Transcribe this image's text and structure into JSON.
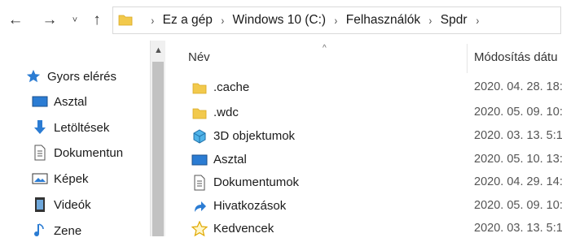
{
  "nav": {
    "back_icon": "←",
    "forward_icon": "→",
    "recent_icon": "˅",
    "up_icon": "↑"
  },
  "address": {
    "crumbs": [
      "Ez a gép",
      "Windows 10 (C:)",
      "Felhasználók",
      "Spdr"
    ],
    "separator": "›"
  },
  "sidebar": {
    "quick_access": "Gyors elérés",
    "items": [
      {
        "label": "Asztal",
        "icon": "desktop-icon",
        "pinned": true
      },
      {
        "label": "Letöltések",
        "icon": "download-icon",
        "pinned": true
      },
      {
        "label": "Dokumentun",
        "icon": "document-icon",
        "pinned": true
      },
      {
        "label": "Képek",
        "icon": "pictures-icon",
        "pinned": true
      },
      {
        "label": "Videók",
        "icon": "videos-icon",
        "pinned": false
      },
      {
        "label": "Zene",
        "icon": "music-icon",
        "pinned": false
      }
    ],
    "pin_glyph": "📌"
  },
  "scroll": {
    "up_glyph": "▲"
  },
  "columns": {
    "name": "Név",
    "date": "Módosítás dátu",
    "sort_indicator": "^"
  },
  "files": [
    {
      "name": ".cache",
      "icon": "folder-icon",
      "date": "2020. 04. 28. 18:"
    },
    {
      "name": ".wdc",
      "icon": "folder-icon",
      "date": "2020. 05. 09. 10:"
    },
    {
      "name": "3D objektumok",
      "icon": "3d-objects-icon",
      "date": "2020. 03. 13. 5:1"
    },
    {
      "name": "Asztal",
      "icon": "desktop-icon",
      "date": "2020. 05. 10. 13:"
    },
    {
      "name": "Dokumentumok",
      "icon": "document-icon",
      "date": "2020. 04. 29. 14:"
    },
    {
      "name": "Hivatkozások",
      "icon": "link-icon",
      "date": "2020. 05. 09. 10:"
    },
    {
      "name": "Kedvencek",
      "icon": "favorites-star-icon",
      "date": "2020. 03. 13. 5:1"
    }
  ],
  "colors": {
    "folder": "#f2c94c",
    "accent_blue": "#2b7cd3",
    "scroll_thumb": "#c2c2c2"
  }
}
